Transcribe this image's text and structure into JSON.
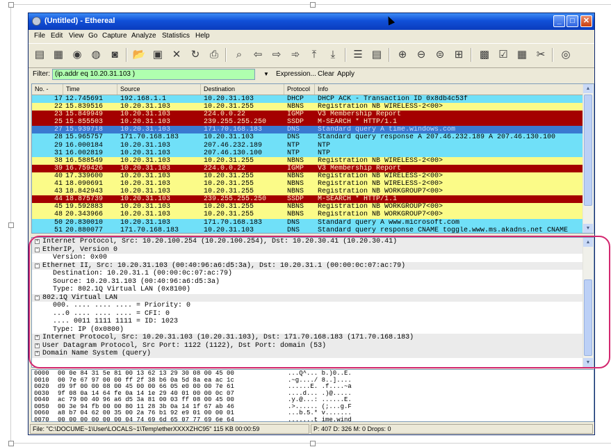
{
  "window": {
    "title": "(Untitled) - Ethereal"
  },
  "menu": [
    "File",
    "Edit",
    "View",
    "Go",
    "Capture",
    "Analyze",
    "Statistics",
    "Help"
  ],
  "toolbar": {
    "icons": [
      "interface-list-icon",
      "capture-options-icon",
      "start-capture-icon",
      "restart-capture-icon",
      "stop-capture-icon",
      "open-file-icon",
      "save-file-icon",
      "close-file-icon",
      "reload-icon",
      "print-icon",
      "find-packet-icon",
      "go-back-icon",
      "go-forward-icon",
      "go-to-packet-icon",
      "go-first-packet-icon",
      "go-last-packet-icon",
      "colorize-icon",
      "autoscroll-icon",
      "zoom-in-icon",
      "zoom-out-icon",
      "normal-size-icon",
      "resize-columns-icon",
      "capture-filters-icon",
      "display-filters-icon",
      "coloring-rules-icon",
      "preferences-icon",
      "help-icon"
    ]
  },
  "filter": {
    "label": "Filter:",
    "value": "(ip.addr eq 10.20.31.103 )",
    "expression": "Expression...",
    "clear": "Clear",
    "apply": "Apply"
  },
  "packet_list": {
    "columns": [
      "No. -",
      "Time",
      "Source",
      "Destination",
      "Protocol",
      "Info"
    ],
    "rows": [
      {
        "no": "17",
        "time": "12.745691",
        "src": "192.168.1.1",
        "dst": "10.20.31.103",
        "proto": "DHCP",
        "info": "DHCP ACK      - Transaction ID 0x8db4c53f",
        "bg": "#70e0f8",
        "fg": "#000000"
      },
      {
        "no": "22",
        "time": "15.839516",
        "src": "10.20.31.103",
        "dst": "10.20.31.255",
        "proto": "NBNS",
        "info": "Registration NB WIRELESS-2<00>",
        "bg": "#fbfb88",
        "fg": "#000000"
      },
      {
        "no": "23",
        "time": "15.849949",
        "src": "10.20.31.103",
        "dst": "224.0.0.22",
        "proto": "IGMP",
        "info": "V3 Membership Report",
        "bg": "#a40000",
        "fg": "#fff0c8"
      },
      {
        "no": "25",
        "time": "15.855503",
        "src": "10.20.31.103",
        "dst": "239.255.255.250",
        "proto": "SSDP",
        "info": "M-SEARCH * HTTP/1.1",
        "bg": "#a40000",
        "fg": "#fff0c8"
      },
      {
        "no": "27",
        "time": "15.939718",
        "src": "10.20.31.103",
        "dst": "171.70.168.183",
        "proto": "DNS",
        "info": "Standard query A time.windows.com",
        "bg": "#3a79d0",
        "fg": "#c8dcff"
      },
      {
        "no": "28",
        "time": "15.965757",
        "src": "171.70.168.183",
        "dst": "10.20.31.103",
        "proto": "DNS",
        "info": "Standard query response A 207.46.232.189 A 207.46.130.100",
        "bg": "#70e0f8",
        "fg": "#000000"
      },
      {
        "no": "29",
        "time": "16.000184",
        "src": "10.20.31.103",
        "dst": "207.46.232.189",
        "proto": "NTP",
        "info": "NTP",
        "bg": "#70e0f8",
        "fg": "#000000"
      },
      {
        "no": "31",
        "time": "16.002819",
        "src": "10.20.31.103",
        "dst": "207.46.130.100",
        "proto": "NTP",
        "info": "NTP",
        "bg": "#70e0f8",
        "fg": "#000000"
      },
      {
        "no": "38",
        "time": "16.588549",
        "src": "10.20.31.103",
        "dst": "10.20.31.255",
        "proto": "NBNS",
        "info": "Registration NB WIRELESS-2<00>",
        "bg": "#fbfb88",
        "fg": "#000000"
      },
      {
        "no": "39",
        "time": "16.759426",
        "src": "10.20.31.103",
        "dst": "224.0.0.22",
        "proto": "IGMP",
        "info": "V3 Membership Report",
        "bg": "#a40000",
        "fg": "#fff0c8"
      },
      {
        "no": "40",
        "time": "17.339600",
        "src": "10.20.31.103",
        "dst": "10.20.31.255",
        "proto": "NBNS",
        "info": "Registration NB WIRELESS-2<00>",
        "bg": "#fbfb88",
        "fg": "#000000"
      },
      {
        "no": "41",
        "time": "18.090691",
        "src": "10.20.31.103",
        "dst": "10.20.31.255",
        "proto": "NBNS",
        "info": "Registration NB WIRELESS-2<00>",
        "bg": "#fbfb88",
        "fg": "#000000"
      },
      {
        "no": "43",
        "time": "18.842943",
        "src": "10.20.31.103",
        "dst": "10.20.31.255",
        "proto": "NBNS",
        "info": "Registration NB WORKGROUP7<00>",
        "bg": "#fbfb88",
        "fg": "#000000"
      },
      {
        "no": "44",
        "time": "18.875739",
        "src": "10.20.31.103",
        "dst": "239.255.255.250",
        "proto": "SSDP",
        "info": "M-SEARCH * HTTP/1.1",
        "bg": "#a40000",
        "fg": "#fff0c8"
      },
      {
        "no": "45",
        "time": "19.592883",
        "src": "10.20.31.103",
        "dst": "10.20.31.255",
        "proto": "NBNS",
        "info": "Registration NB WORKGROUP7<00>",
        "bg": "#fbfb88",
        "fg": "#000000"
      },
      {
        "no": "48",
        "time": "20.343966",
        "src": "10.20.31.103",
        "dst": "10.20.31.255",
        "proto": "NBNS",
        "info": "Registration NB WORKGROUP7<00>",
        "bg": "#fbfb88",
        "fg": "#000000"
      },
      {
        "no": "50",
        "time": "20.830010",
        "src": "10.20.31.103",
        "dst": "171.70.168.183",
        "proto": "DNS",
        "info": "Standard query A www.microsoft.com",
        "bg": "#70e0f8",
        "fg": "#000000"
      },
      {
        "no": "51",
        "time": "20.880077",
        "src": "171.70.168.183",
        "dst": "10.20.31.103",
        "proto": "DNS",
        "info": "Standard query response CNAME toggle.www.ms.akadns.net CNAME",
        "bg": "#70e0f8",
        "fg": "#000000"
      }
    ]
  },
  "details": [
    {
      "exp": "+",
      "indent": 0,
      "gray": true,
      "text": "Internet Protocol, Src: 10.20.100.254 (10.20.100.254), Dst: 10.20.30.41 (10.20.30.41)"
    },
    {
      "exp": "-",
      "indent": 0,
      "gray": true,
      "text": "EtherIP, Version 0"
    },
    {
      "exp": "",
      "indent": 1,
      "gray": false,
      "text": "Version: 0x00"
    },
    {
      "exp": "-",
      "indent": 0,
      "gray": true,
      "text": "Ethernet II, Src: 10.20.31.103 (00:40:96:a6:d5:3a), Dst: 10.20.31.1 (00:00:0c:07:ac:79)"
    },
    {
      "exp": "",
      "indent": 1,
      "gray": false,
      "text": "Destination: 10.20.31.1 (00:00:0c:07:ac:79)"
    },
    {
      "exp": "",
      "indent": 1,
      "gray": false,
      "text": "Source: 10.20.31.103 (00:40:96:a6:d5:3a)"
    },
    {
      "exp": "",
      "indent": 1,
      "gray": false,
      "text": "Type: 802.1Q Virtual LAN (0x8100)"
    },
    {
      "exp": "-",
      "indent": 0,
      "gray": true,
      "text": "802.1Q Virtual LAN"
    },
    {
      "exp": "",
      "indent": 1,
      "gray": false,
      "text": "000. .... .... .... = Priority: 0"
    },
    {
      "exp": "",
      "indent": 1,
      "gray": false,
      "text": "...0 .... .... .... = CFI: 0"
    },
    {
      "exp": "",
      "indent": 1,
      "gray": false,
      "text": ".... 0011 1111 1111 = ID: 1023"
    },
    {
      "exp": "",
      "indent": 1,
      "gray": false,
      "text": "Type: IP (0x0800)"
    },
    {
      "exp": "+",
      "indent": 0,
      "gray": true,
      "text": "Internet Protocol, Src: 10.20.31.103 (10.20.31.103), Dst: 171.70.168.183 (171.70.168.183)"
    },
    {
      "exp": "+",
      "indent": 0,
      "gray": true,
      "text": "User Datagram Protocol, Src Port: 1122 (1122), Dst Port: domain (53)"
    },
    {
      "exp": "+",
      "indent": 0,
      "gray": true,
      "text": "Domain Name System (query)"
    }
  ],
  "hex": [
    {
      "off": "0000",
      "bytes": "00 0e 84 31 5e 81 00 13  62 13 29 30 08 00 45 00",
      "ascii": "...Q^...  b.)0..E."
    },
    {
      "off": "0010",
      "bytes": "00 7e 67 97 00 00 ff 2f  38 b6 0a 5d 8a ea ac 1c",
      "ascii": ".~g..../ 8..]...."
    },
    {
      "off": "0020",
      "bytes": "d9 9f 00 00 08 00 45 00  00 66 05 e0 00 00 7e 61",
      "ascii": "......E. .f....~a"
    },
    {
      "off": "0030",
      "bytes": "9f 08 0a 14 64 fe 0a 14  1e 29 40 01 00 00 0c 07",
      "ascii": "....d... .)@....."
    },
    {
      "off": "0040",
      "bytes": "ac 79 00 40 96 a6 d5 3a  81 00 03 ff 08 00 45 00",
      "ascii": ".y.@...: ......E."
    },
    {
      "off": "0050",
      "bytes": "00 3e 94 fb 00 00 80 11  28 3b 0a 14 1f 67 ab 46",
      "ascii": ".>...... (;...g.F"
    },
    {
      "off": "0060",
      "bytes": "a8 b7 04 62 00 35 00 2a  76 b1 92 e9 01 00 00 01",
      "ascii": "...b.5.* v......."
    },
    {
      "off": "0070",
      "bytes": "00 00 00 00 00 00 04 74  69 6d 65 07 77 69 6e 64",
      "ascii": ".......t ime.wind"
    }
  ],
  "status": {
    "file": "File: \"C:\\DOCUME~1\\User\\LOCALS~1\\Temp\\etherXXXXZHC95\" 115 KB 00:00:59",
    "counts": "P: 407 D: 326 M: 0 Drops: 0"
  }
}
